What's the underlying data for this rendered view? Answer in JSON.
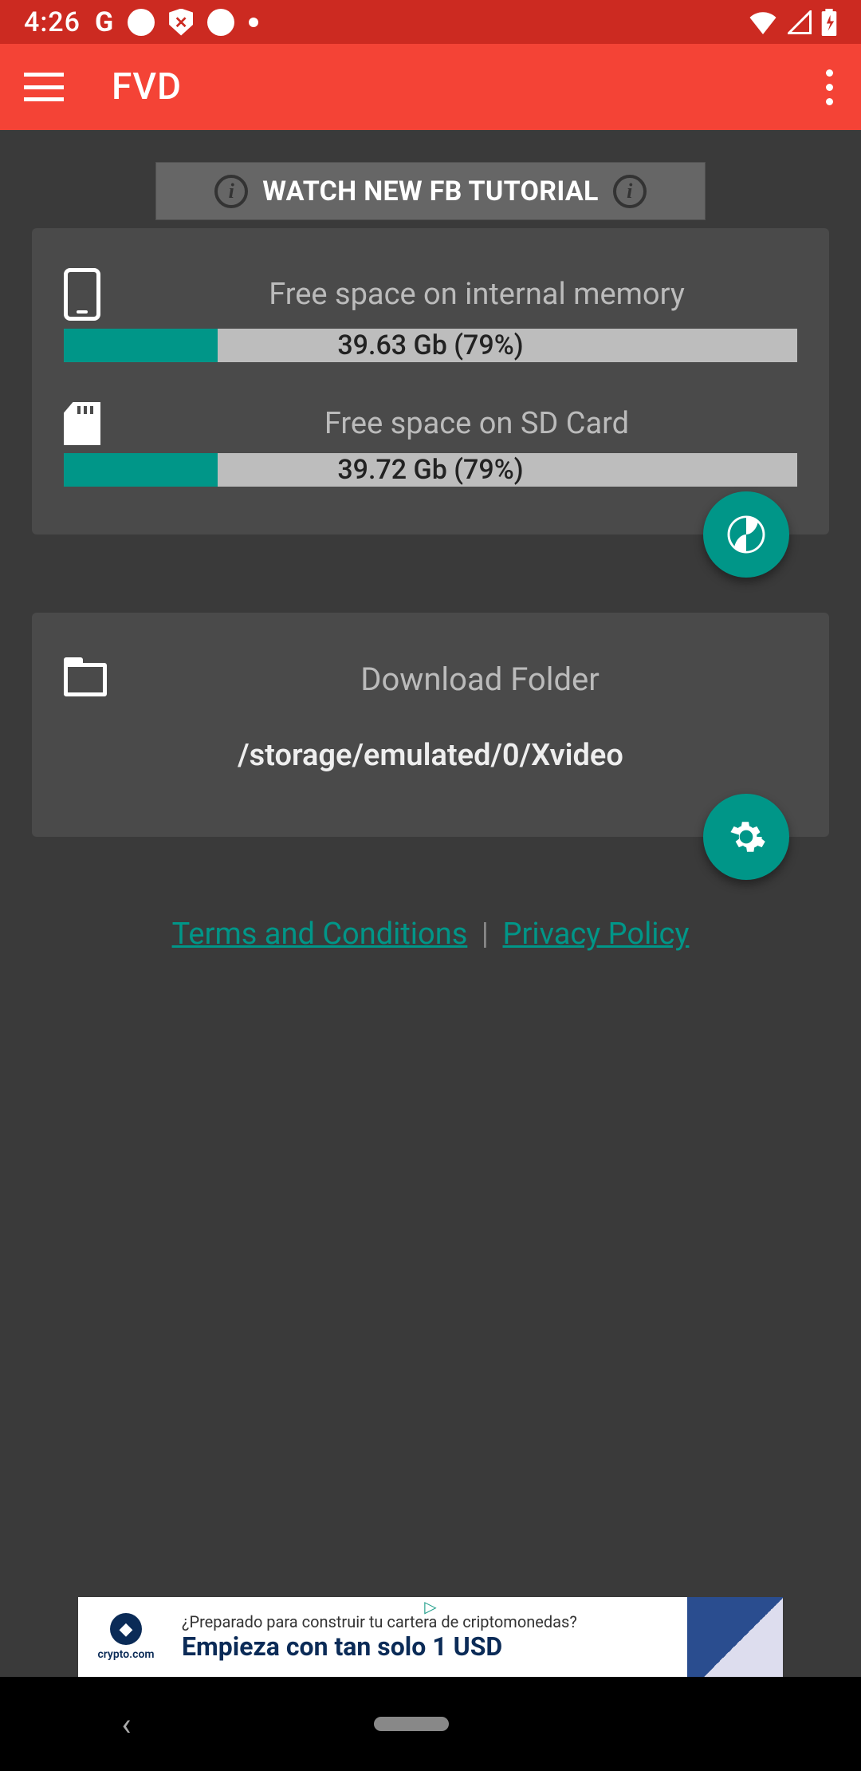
{
  "status_bar": {
    "time": "4:26",
    "google_letter": "G"
  },
  "app_bar": {
    "title": "FVD"
  },
  "tutorial_button": {
    "label": "WATCH NEW FB TUTORIAL"
  },
  "storage": {
    "internal": {
      "label": "Free space on internal memory",
      "value_text": "39.63 Gb  (79%)",
      "used_percent": 21
    },
    "sd": {
      "label": "Free space on SD Card",
      "value_text": "39.72 Gb (79%)",
      "used_percent": 21
    }
  },
  "download_folder": {
    "label": "Download Folder",
    "path": "/storage/emulated/0/Xvideo"
  },
  "legal": {
    "terms": "Terms and Conditions",
    "separator": "|",
    "privacy": "Privacy Policy"
  },
  "ad": {
    "logo_text": "crypto.com",
    "line1": "¿Preparado para construir tu cartera de criptomonedas?",
    "line2": "Empieza con tan solo 1 USD",
    "badge": "▷"
  },
  "colors": {
    "status_red": "#cc2a21",
    "appbar_red": "#f44336",
    "teal": "#009688",
    "bg": "#3a3a3a",
    "card": "#4a4a4a"
  }
}
